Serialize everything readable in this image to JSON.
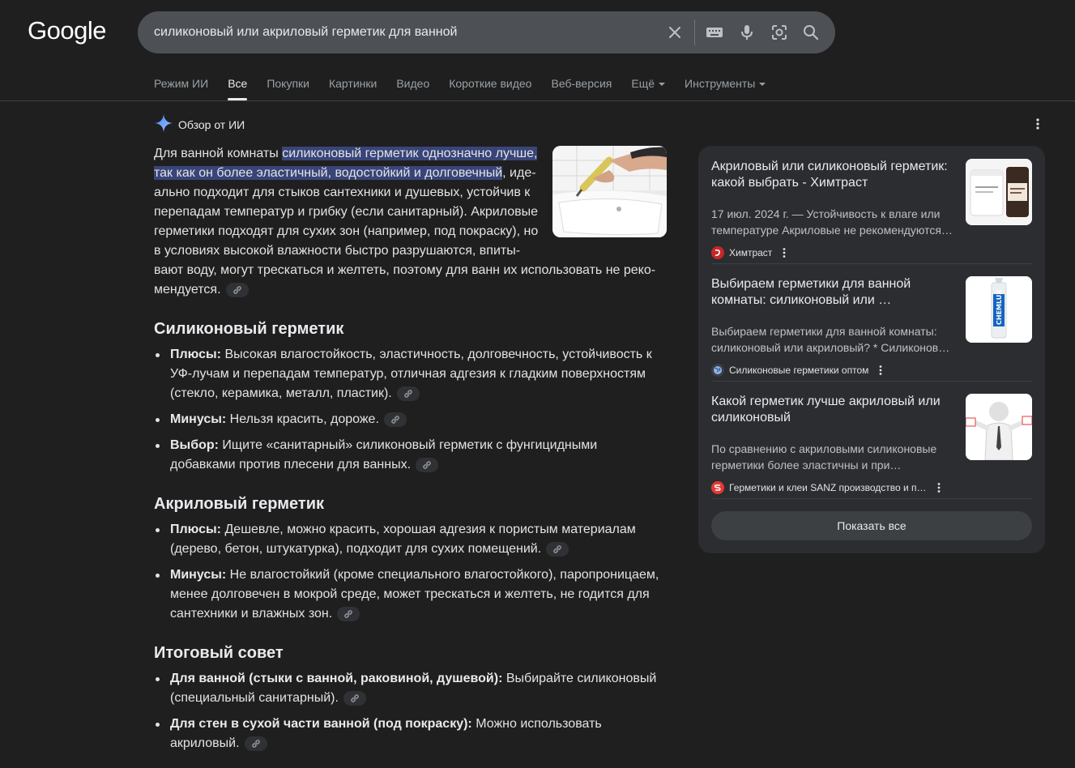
{
  "header": {
    "logo": "Google",
    "search": {
      "value": "силиконовый или акриловый герметик для ванной",
      "icons": [
        "close-icon",
        "keyboard-icon",
        "mic-icon",
        "lens-icon",
        "search-icon"
      ]
    }
  },
  "tabs": [
    {
      "label": "Режим ИИ"
    },
    {
      "label": "Все"
    },
    {
      "label": "Покупки"
    },
    {
      "label": "Картинки"
    },
    {
      "label": "Видео"
    },
    {
      "label": "Короткие видео"
    },
    {
      "label": "Веб-версия"
    },
    {
      "label": "Ещё"
    },
    {
      "label": "Инструменты"
    }
  ],
  "ai_overview": {
    "title": "Обзор от ИИ",
    "intro": {
      "before": "Для ванной комнаты ",
      "highlight": "силиконовый герметик однозначно лучше, так как он более эластичный, водостойкий и долговечный",
      "after": ", иде­ально подходит для стыков сантехники и душевых, устойчив к перепадам температур и грибку (если санитарный). Акриловые герметики подходят для сухих зон (например, под покраску), но в условиях высокой влажности быстро разрушаются, впиты­вают воду, могут трескаться и желтеть, поэтому для ванн их использовать не реко­мендуется."
    },
    "sections": [
      {
        "heading": "Силиконовый герметик",
        "items": [
          {
            "label": "Плюсы:",
            "text": " Высокая влагостойкость, эластичность, долговечность, устойчивость к УФ-лучам и перепадам температур, отличная адгезия к гладким поверхностям (стекло, керамика, металл, пластик)."
          },
          {
            "label": "Минусы:",
            "text": " Нельзя красить, дороже."
          },
          {
            "label": "Выбор:",
            "text": " Ищите «санитарный» силиконовый герметик с фунгицидными добавками против плесени для ванных."
          }
        ]
      },
      {
        "heading": "Акриловый герметик",
        "items": [
          {
            "label": "Плюсы:",
            "text": " Дешевле, можно красить, хорошая адгезия к пористым материалам (дерево, бетон, штукатурка), подходит для сухих помещений."
          },
          {
            "label": "Минусы:",
            "text": " Не влагостойкий (кроме специального влагостойкого), паропроницаем, менее долговечен в мокрой среде, может трескаться и желтеть, не годится для сантехники и влажных зон."
          }
        ]
      },
      {
        "heading": "Итоговый совет",
        "items": [
          {
            "label": "Для ванной (стыки с ванной, раковиной, душевой):",
            "text": " Выбирайте силиконовый (специальный санитарный)."
          },
          {
            "label": "Для стен в сухой части ванной (под покраску):",
            "text": " Можно использовать акриловый."
          }
        ]
      }
    ]
  },
  "sources": {
    "cards": [
      {
        "title": "Акриловый или силиконовый герметик: какой выбрать - Химтраст",
        "snippet1": "17 июл. 2024 г. — Устойчивость к влаге или",
        "snippet2": "температуре Акриловые не рекомендуются…",
        "source": "Химтраст",
        "favicon_color": "#c62828"
      },
      {
        "title": "Выбираем герметики для ванной комнаты: силиконовый или …",
        "snippet1": "Выбираем герметики для ванной комнаты:",
        "snippet2": "силиконовый или акриловый? * Силиконов…",
        "source": "Силиконовые герметики оптом",
        "favicon_color": "#8ab4f8",
        "thumb_text": "CHEMLUX"
      },
      {
        "title": "Какой герметик лучше акриловый или силиконовый",
        "snippet1": "По сравнению с акриловыми силиконовые",
        "snippet2": "герметики более эластичны и при…",
        "source": "Герметики и клеи SANZ производство и п…",
        "favicon_color": "#e53935"
      }
    ],
    "show_all": "Показать все"
  }
}
